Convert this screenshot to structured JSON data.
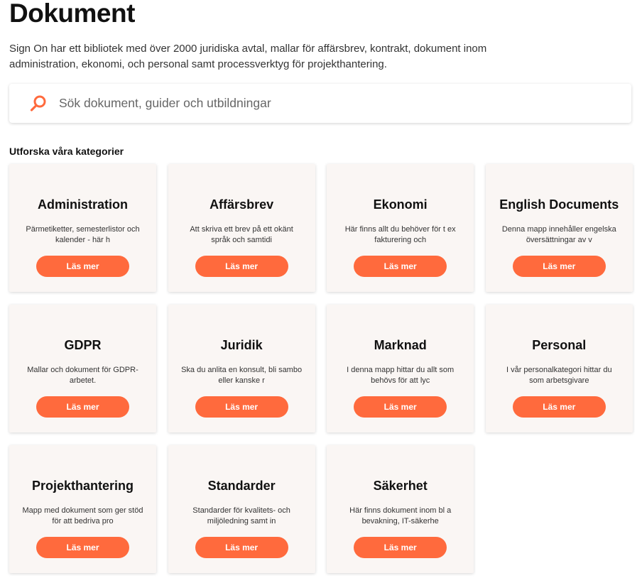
{
  "header": {
    "title": "Dokument",
    "intro": "Sign On har ett bibliotek med över 2000 juridiska avtal, mallar för affärsbrev, kontrakt, dokument inom administration, ekonomi, och personal samt processverktyg för projekthantering."
  },
  "search": {
    "placeholder": "Sök dokument, guider och utbildningar",
    "icon": "search-icon"
  },
  "categories_title": "Utforska våra kategorier",
  "colors": {
    "accent": "#ff6a3d",
    "card_bg": "#faf6f4"
  },
  "categories": [
    {
      "title": "Administration",
      "desc": "Pärmetiketter, semesterlistor och kalender - här h",
      "button": "Läs mer"
    },
    {
      "title": "Affärsbrev",
      "desc": "Att skriva ett brev på ett okänt språk och samtidi",
      "button": "Läs mer"
    },
    {
      "title": "Ekonomi",
      "desc": "Här finns allt du behöver för t ex fakturering och",
      "button": "Läs mer"
    },
    {
      "title": "English Documents",
      "desc": "Denna mapp innehåller engelska översättningar av v",
      "button": "Läs mer"
    },
    {
      "title": "GDPR",
      "desc": "Mallar och dokument för GDPR-arbetet.",
      "button": "Läs mer"
    },
    {
      "title": "Juridik",
      "desc": "Ska du anlita en konsult, bli sambo eller kanske r",
      "button": "Läs mer"
    },
    {
      "title": "Marknad",
      "desc": "I denna mapp hittar du allt som behövs för att lyc",
      "button": "Läs mer"
    },
    {
      "title": "Personal",
      "desc": "I vår personalkategori hittar du som arbetsgivare",
      "button": "Läs mer"
    },
    {
      "title": "Projekthantering",
      "desc": "Mapp med dokument som ger stöd för att bedriva pro",
      "button": "Läs mer"
    },
    {
      "title": "Standarder",
      "desc": "Standarder för kvalitets- och miljöledning samt in",
      "button": "Läs mer"
    },
    {
      "title": "Säkerhet",
      "desc": "Här finns dokument inom bl a bevakning, IT-säkerhe",
      "button": "Läs mer"
    }
  ]
}
